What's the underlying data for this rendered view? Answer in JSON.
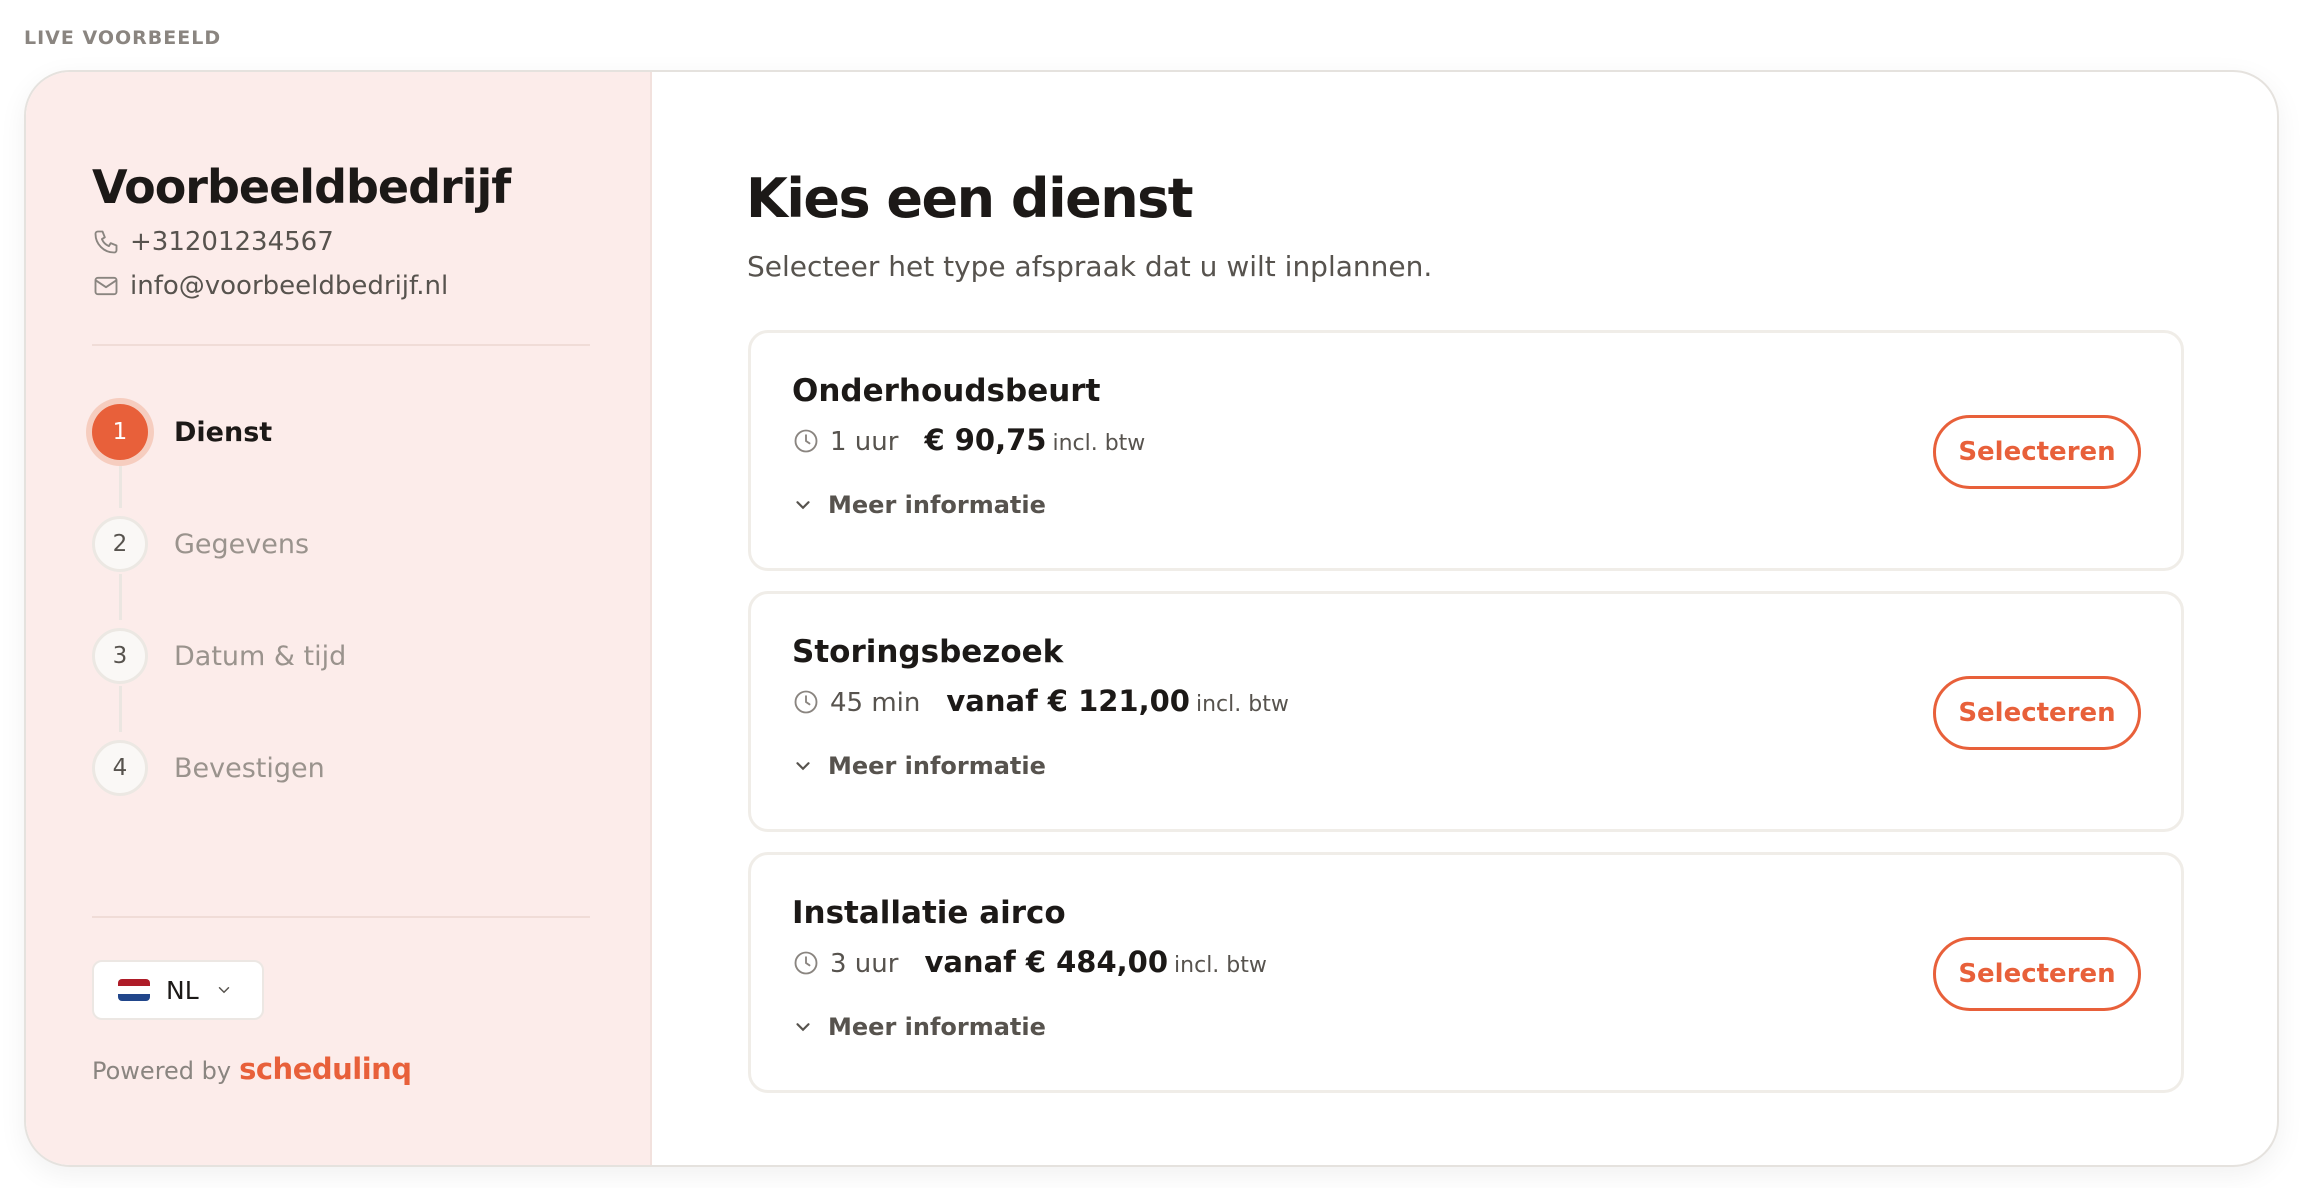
{
  "live_label": "LIVE VOORBEELD",
  "company": {
    "name": "Voorbeeldbedrijf",
    "phone": "+31201234567",
    "email": "info@voorbeeldbedrijf.nl"
  },
  "steps": [
    {
      "number": "1",
      "label": "Dienst",
      "active": true
    },
    {
      "number": "2",
      "label": "Gegevens",
      "active": false
    },
    {
      "number": "3",
      "label": "Datum & tijd",
      "active": false
    },
    {
      "number": "4",
      "label": "Bevestigen",
      "active": false
    }
  ],
  "language": {
    "code": "NL",
    "flag_colors": [
      "#ae1c28",
      "#ffffff",
      "#21468b"
    ]
  },
  "powered": {
    "prefix": "Powered by",
    "brand": "schedulinq"
  },
  "main": {
    "title": "Kies een dienst",
    "subtitle": "Selecteer het type afspraak dat u wilt inplannen."
  },
  "services": [
    {
      "name": "Onderhoudsbeurt",
      "duration": "1 uur",
      "price": "€ 90,75",
      "vat": "incl. btw",
      "more": "Meer informatie",
      "button": "Selecteren"
    },
    {
      "name": "Storingsbezoek",
      "duration": "45 min",
      "price": "vanaf € 121,00",
      "vat": "incl. btw",
      "more": "Meer informatie",
      "button": "Selecteren"
    },
    {
      "name": "Installatie airco",
      "duration": "3 uur",
      "price": "vanaf € 484,00",
      "vat": "incl. btw",
      "more": "Meer informatie",
      "button": "Selecteren"
    }
  ],
  "colors": {
    "accent": "#e8603a",
    "sidebar_bg": "#fcecea"
  }
}
